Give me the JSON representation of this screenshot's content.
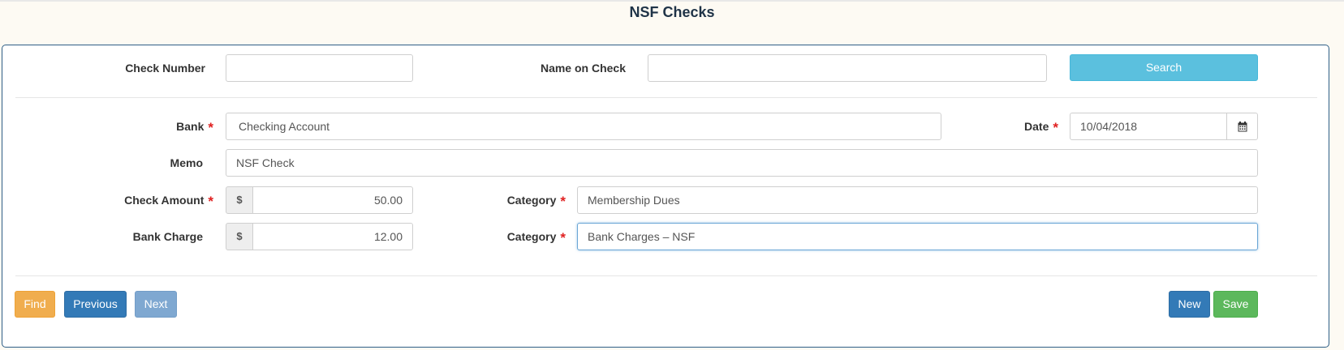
{
  "page": {
    "title": "NSF Checks"
  },
  "search": {
    "check_number_label": "Check Number",
    "check_number_value": "",
    "name_on_check_label": "Name on Check",
    "name_on_check_value": "",
    "search_button": "Search"
  },
  "form": {
    "bank_label": "Bank",
    "bank_value": "Checking Account",
    "date_label": "Date",
    "date_value": "10/04/2018",
    "memo_label": "Memo",
    "memo_value": "NSF Check",
    "check_amount_label": "Check Amount",
    "check_amount_currency": "$",
    "check_amount_value": "50.00",
    "category1_label": "Category",
    "category1_value": "Membership Dues",
    "bank_charge_label": "Bank Charge",
    "bank_charge_currency": "$",
    "bank_charge_value": "12.00",
    "category2_label": "Category",
    "category2_value": "Bank Charges – NSF",
    "required_marker": "*"
  },
  "actions": {
    "find": "Find",
    "previous": "Previous",
    "next": "Next",
    "new": "New",
    "save": "Save"
  },
  "icons": {
    "date_picker": "calendar-icon"
  },
  "colors": {
    "panel_border": "#2e5e86",
    "search_button": "#5bc0de",
    "find_button": "#f0ad4e",
    "primary_button": "#337ab7",
    "next_button_disabled": "#7fa8d1",
    "save_button": "#5cb85c",
    "required": "#e02020"
  }
}
